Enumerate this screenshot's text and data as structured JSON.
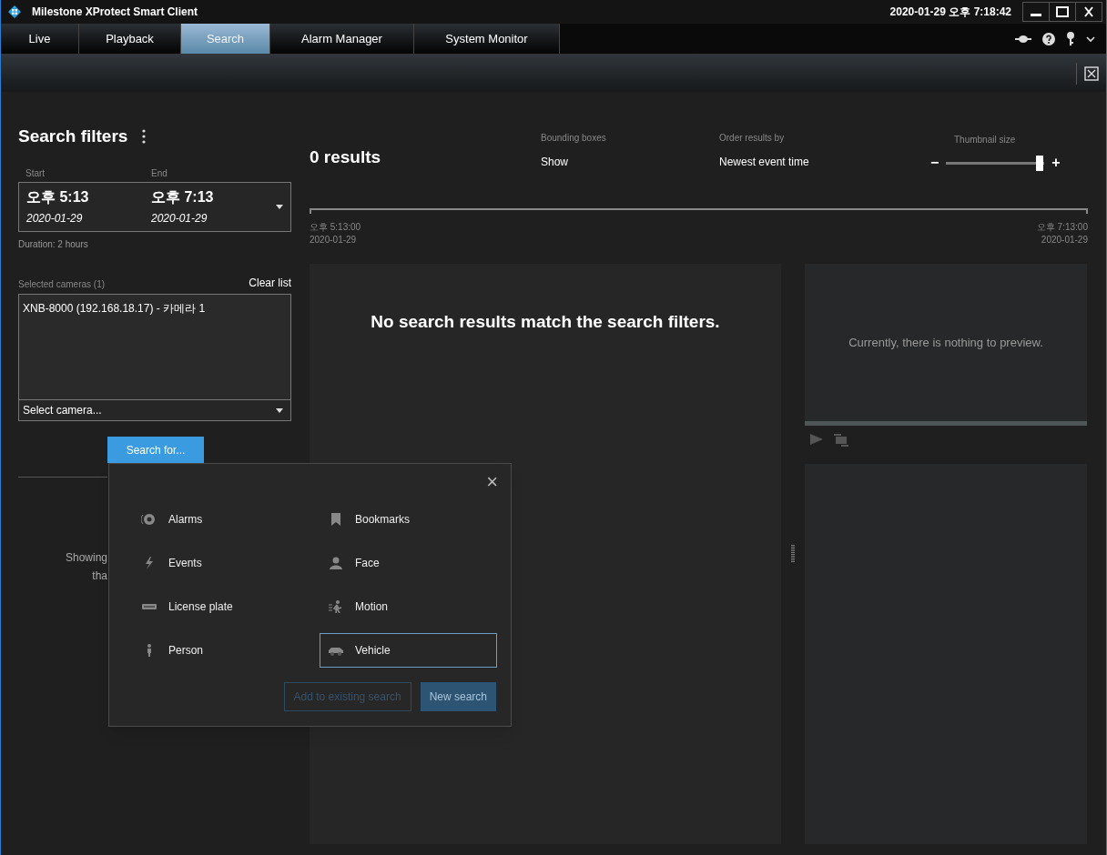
{
  "window": {
    "title": "Milestone XProtect Smart Client",
    "datetime": "2020-01-29 오후 7:18:42"
  },
  "tabs": [
    {
      "label": "Live",
      "selected": false
    },
    {
      "label": "Playback",
      "selected": false
    },
    {
      "label": "Search",
      "selected": true
    },
    {
      "label": "Alarm Manager",
      "selected": false
    },
    {
      "label": "System Monitor",
      "selected": false
    }
  ],
  "search_filters": {
    "title": "Search filters",
    "start_label": "Start",
    "end_label": "End",
    "start_time": "오후 5:13",
    "start_date": "2020-01-29",
    "end_time": "오후 7:13",
    "end_date": "2020-01-29",
    "duration_label": "Duration:",
    "duration": "2 hours",
    "cameras_label": "Selected cameras (1)",
    "clear_list": "Clear list",
    "cameras": [
      "XNB-8000 (192.168.18.17) - 카메라 1"
    ],
    "select_camera": "Select camera...",
    "search_for": "Search for...",
    "hint_lines": [
      "Showing",
      "tha"
    ]
  },
  "results": {
    "count": "0 results",
    "bounding_boxes_label": "Bounding boxes",
    "bounding_boxes": "Show",
    "order_label": "Order results by",
    "order": "Newest event time",
    "thumbnail_label": "Thumbnail size",
    "thumbnail_minus": "−",
    "thumbnail_plus": "+",
    "thumbnail_slider": {
      "level": 0.95
    },
    "timeline_start": [
      "오후 5:13:00",
      "2020-01-29"
    ],
    "timeline_end": [
      "오후 7:13:00",
      "2020-01-29"
    ],
    "message": "No search results match the search filters."
  },
  "preview": {
    "message": "Currently, there is nothing to preview."
  },
  "search_popup": {
    "close": "×",
    "items": [
      {
        "label": "Alarms",
        "kind": "alarms",
        "selected": false
      },
      {
        "label": "Bookmarks",
        "kind": "bookmarks",
        "selected": false
      },
      {
        "label": "Events",
        "kind": "events",
        "selected": false
      },
      {
        "label": "Face",
        "kind": "face",
        "selected": false
      },
      {
        "label": "License plate",
        "kind": "plate",
        "selected": false
      },
      {
        "label": "Motion",
        "kind": "motion",
        "selected": false
      },
      {
        "label": "Person",
        "kind": "person",
        "selected": false
      },
      {
        "label": "Vehicle",
        "kind": "vehicle",
        "selected": true
      }
    ],
    "buttons": [
      {
        "label": "Add to existing search",
        "disabled": true
      },
      {
        "label": "New search",
        "disabled": false
      }
    ]
  }
}
